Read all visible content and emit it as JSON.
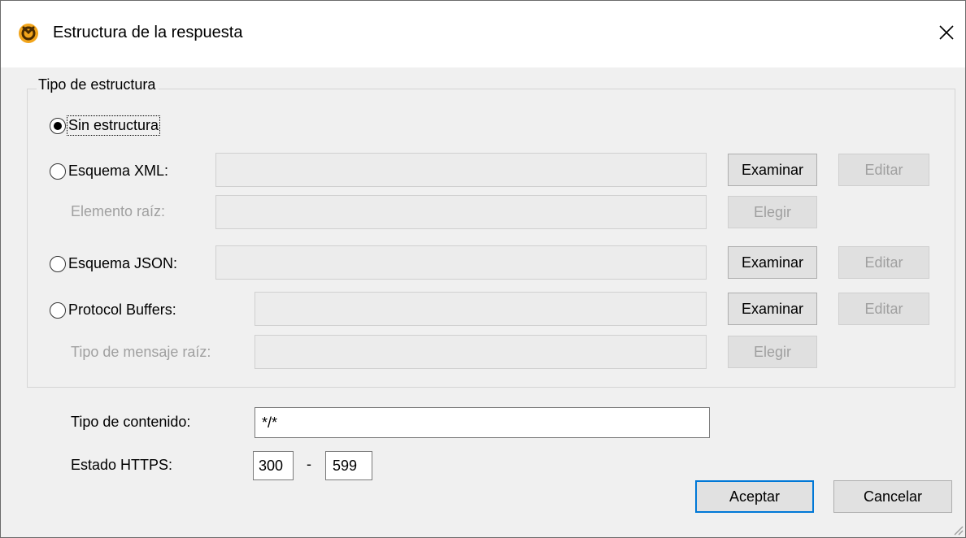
{
  "window": {
    "title": "Estructura de la respuesta",
    "icon": "mapforce-logo-icon",
    "close_icon": "close-icon"
  },
  "structure_group": {
    "label": "Tipo de estructura",
    "options": {
      "none": {
        "label": "Sin estructura",
        "selected": true
      },
      "xml": {
        "label": "Esquema XML:",
        "path_value": "",
        "browse_label": "Examinar",
        "edit_label": "Editar",
        "root_label": "Elemento raíz:",
        "root_value": "",
        "choose_label": "Elegir",
        "selected": false
      },
      "json": {
        "label": "Esquema JSON:",
        "path_value": "",
        "browse_label": "Examinar",
        "edit_label": "Editar",
        "selected": false
      },
      "protobuf": {
        "label": "Protocol Buffers:",
        "path_value": "",
        "browse_label": "Examinar",
        "edit_label": "Editar",
        "root_label": "Tipo de mensaje raíz:",
        "root_value": "",
        "choose_label": "Elegir",
        "selected": false
      }
    }
  },
  "content_type": {
    "label": "Tipo de contenido:",
    "value": "*/*"
  },
  "https_status": {
    "label": "Estado HTTPS:",
    "from": "300",
    "separator": "-",
    "to": "599"
  },
  "footer": {
    "ok_label": "Aceptar",
    "cancel_label": "Cancelar"
  }
}
